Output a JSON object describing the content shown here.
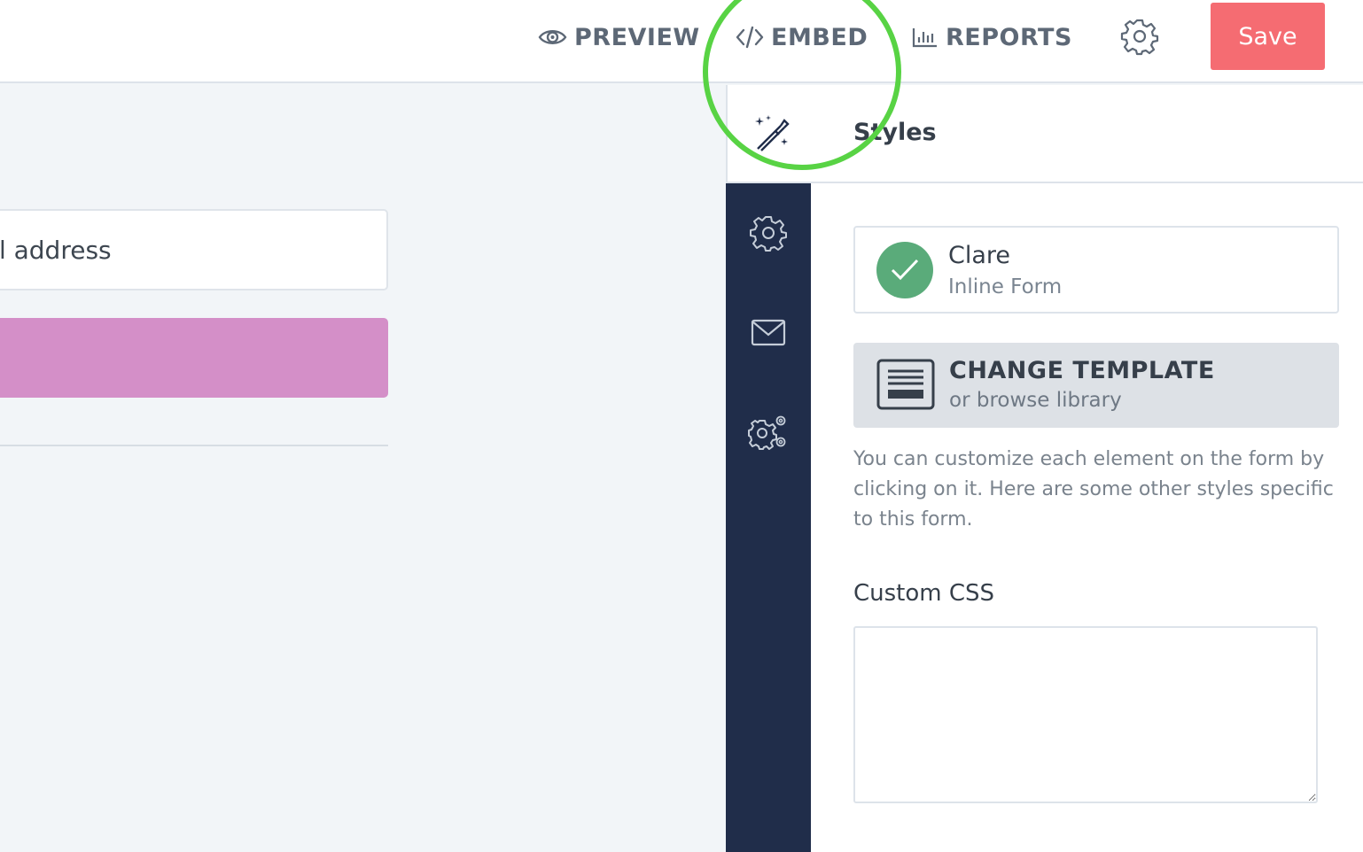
{
  "topbar": {
    "preview_label": "PREVIEW",
    "embed_label": "EMBED",
    "reports_label": "REPORTS",
    "settings_icon": "gear-icon",
    "save_label": "Save"
  },
  "canvas": {
    "email_field_text": "ail address"
  },
  "sidebar": {
    "icons": [
      "magic-wand-icon",
      "gear-icon",
      "envelope-icon",
      "gears-icon"
    ]
  },
  "panel": {
    "title": "Styles",
    "template": {
      "name": "Clare",
      "type": "Inline Form"
    },
    "change_template": {
      "title": "CHANGE TEMPLATE",
      "subtitle": "or browse library"
    },
    "help_text": "You can customize each element on the form by clicking on it. Here are some other styles specific to this form.",
    "custom_css_label": "Custom CSS",
    "custom_css_value": ""
  },
  "colors": {
    "save_button": "#f56c72",
    "sidebar_strip": "#202d4a",
    "subscribe_button": "#d48fc8",
    "check_circle": "#5aab7a",
    "highlight": "#58d344"
  }
}
